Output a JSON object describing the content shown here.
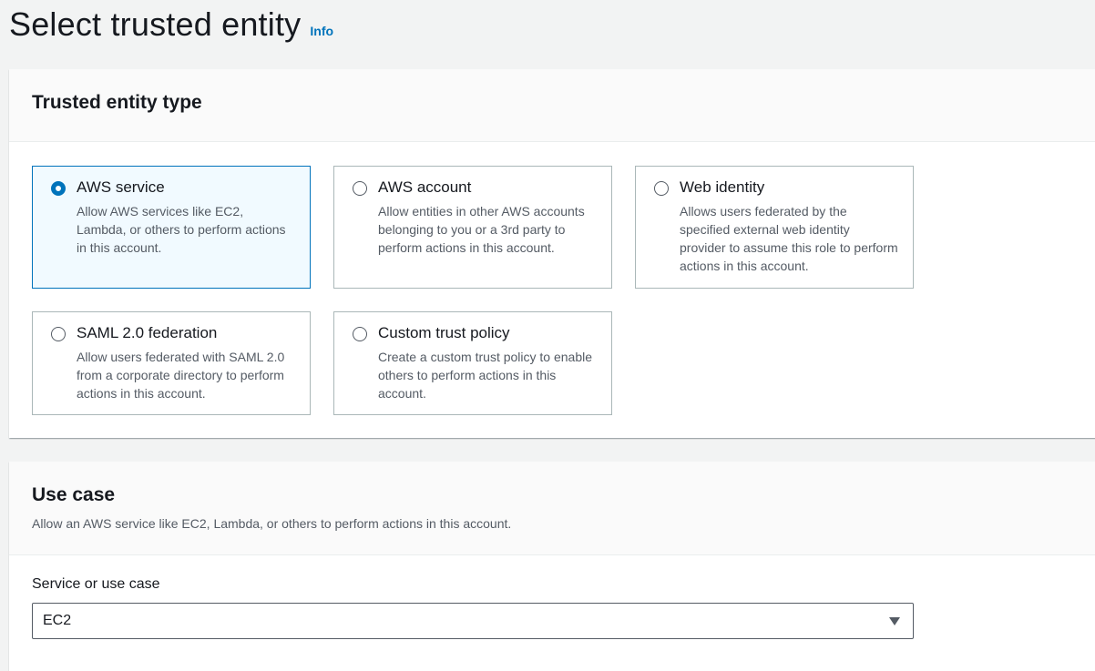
{
  "header": {
    "title": "Select trusted entity",
    "info_label": "Info"
  },
  "trusted_entity": {
    "title": "Trusted entity type",
    "options": [
      {
        "label": "AWS service",
        "description": "Allow AWS services like EC2, Lambda, or others to perform actions in this account.",
        "selected": true
      },
      {
        "label": "AWS account",
        "description": "Allow entities in other AWS accounts belonging to you or a 3rd party to perform actions in this account.",
        "selected": false
      },
      {
        "label": "Web identity",
        "description": "Allows users federated by the specified external web identity provider to assume this role to perform actions in this account.",
        "selected": false
      },
      {
        "label": "SAML 2.0 federation",
        "description": "Allow users federated with SAML 2.0 from a corporate directory to perform actions in this account.",
        "selected": false
      },
      {
        "label": "Custom trust policy",
        "description": "Create a custom trust policy to enable others to perform actions in this account.",
        "selected": false
      }
    ]
  },
  "use_case": {
    "title": "Use case",
    "description": "Allow an AWS service like EC2, Lambda, or others to perform actions in this account.",
    "field_label": "Service or use case",
    "selected_value": "EC2"
  },
  "colors": {
    "accent": "#0073bb",
    "selected_tile_bg": "#f1faff",
    "tile_border": "#aab7b8",
    "page_bg": "#f2f3f3"
  },
  "icons": {
    "select_caret": "caret-down-icon",
    "radio_selected": "radio-selected-icon",
    "radio_unselected": "radio-unselected-icon"
  }
}
